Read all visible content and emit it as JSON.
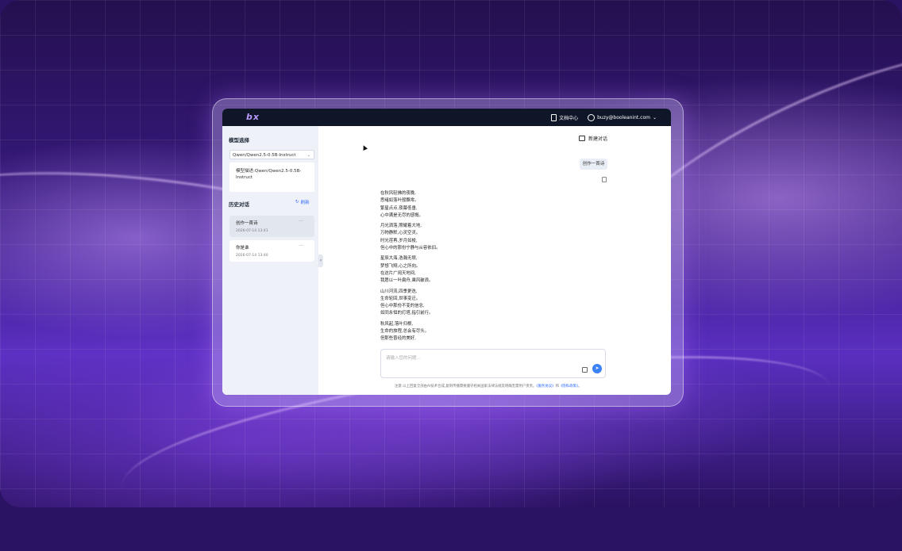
{
  "header": {
    "logo": "bx",
    "docs_label": "文档中心",
    "user_email": "buzy@booleanint.com"
  },
  "sidebar": {
    "model_title": "模型选择",
    "model_selected": "Qwen/Qwen2.5-0.5B-Instruct",
    "model_desc_label": "模型描述:",
    "model_desc_value": "Qwen/Qwen2.5-0.5B-Instruct",
    "history_title": "历史对话",
    "refresh_label": "刷新",
    "history": [
      {
        "title": "创作一首诗",
        "date": "2026-07-14 13:41"
      },
      {
        "title": "你是谁",
        "date": "2026-07-14 13:40"
      }
    ]
  },
  "chat": {
    "new_chat_label": "新建对话",
    "user_message": "创作一首诗",
    "poem": [
      [
        "在秋风轻拂的夜晚,",
        "思绪如落叶般飘零。",
        "繁星点点,夜幕低垂,",
        "心中满是无尽的感慨。"
      ],
      [
        "月光洒落,照耀着大地,",
        "万物静默,心灵空灵。",
        "时光荏苒,岁月如梭,",
        "但心中的那份宁静与从容依旧。"
      ],
      [
        "星辰大海,浩瀚无垠,",
        "梦想飞翔,心之所向。",
        "在这片广阔天地间,",
        "我愿以一叶扁舟,乘风破浪。"
      ],
      [
        "山川河流,四季更迭,",
        "生命轮回,世事变迁。",
        "但心中那份不变的信念,",
        "如同永恒的灯塔,指引前行。"
      ],
      [
        "秋风起,落叶归根,",
        "生命的旅程,总会有尽头。",
        "但那些曾经的美好,"
      ]
    ],
    "input_placeholder": "请输入您的问题...",
    "footer_prefix": "注意:以上回复全部由AI技术合成,复制传播需要遵守相关国家法律法规及明确无需用户责责。",
    "footer_link1": "《服务协议》",
    "footer_and": "和",
    "footer_link2": "《隐私政策》",
    "footer_suffix": "。"
  }
}
